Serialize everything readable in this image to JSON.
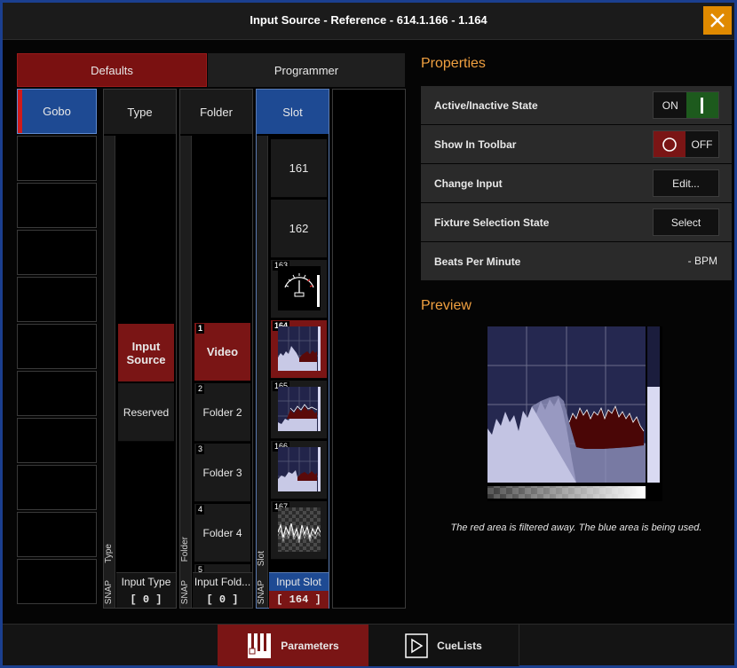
{
  "window": {
    "title": "Input Source - Reference - 614.1.166 - 1.164",
    "close_icon": "close-icon",
    "accent_color": "#1e4a93",
    "selection_color": "#7a1515",
    "heading_color": "#f0a040"
  },
  "tabs": [
    {
      "label": "Defaults",
      "active": true
    },
    {
      "label": "Programmer",
      "active": false
    }
  ],
  "left_list": {
    "items": [
      "Gobo"
    ]
  },
  "type_pane": {
    "header": "Type",
    "snap": "SNAP",
    "side_label": "Type",
    "items": [
      {
        "label": "Input Source",
        "selected": true
      },
      {
        "label": "Reserved",
        "selected": false
      }
    ],
    "footer_title": "Input Type",
    "footer_value": "[ 0 ]"
  },
  "folder_pane": {
    "header": "Folder",
    "snap": "SNAP",
    "side_label": "Folder",
    "items": [
      {
        "num": "1",
        "label": "Video",
        "selected": true
      },
      {
        "num": "2",
        "label": "Folder 2",
        "selected": false
      },
      {
        "num": "3",
        "label": "Folder 3",
        "selected": false
      },
      {
        "num": "4",
        "label": "Folder 4",
        "selected": false
      },
      {
        "num": "5",
        "label": "",
        "selected": false
      }
    ],
    "footer_title": "Input Fold...",
    "footer_value": "[ 0 ]"
  },
  "slot_pane": {
    "header": "Slot",
    "snap": "SNAP",
    "side_label": "Slot",
    "items": [
      {
        "num": "",
        "label": "161",
        "kind": "text"
      },
      {
        "num": "",
        "label": "162",
        "kind": "text"
      },
      {
        "num": "163",
        "label": "",
        "kind": "meter-icon"
      },
      {
        "num": "164",
        "label": "",
        "kind": "spectrum-icon",
        "selected": true
      },
      {
        "num": "165",
        "label": "",
        "kind": "spectrum-icon"
      },
      {
        "num": "166",
        "label": "",
        "kind": "spectrum-icon"
      },
      {
        "num": "167",
        "label": "",
        "kind": "waveform-icon"
      }
    ],
    "footer_title": "Input Slot",
    "footer_value": "[ 164 ]"
  },
  "properties": {
    "heading": "Properties",
    "rows": [
      {
        "label": "Active/Inactive State",
        "control": "toggle",
        "value": "ON",
        "on": true
      },
      {
        "label": "Show In Toolbar",
        "control": "toggle",
        "value": "OFF",
        "on": false
      },
      {
        "label": "Change Input",
        "control": "button",
        "value": "Edit..."
      },
      {
        "label": "Fixture Selection State",
        "control": "button",
        "value": "Select"
      },
      {
        "label": "Beats Per Minute",
        "control": "readout",
        "value": "- BPM"
      }
    ]
  },
  "preview": {
    "heading": "Preview",
    "caption": "The red area is filtered away. The blue area is being used."
  },
  "bottom": {
    "parameters_label": "Parameters",
    "parameters_icon": "sliders-icon",
    "cuelists_label": "CueLists",
    "cuelists_icon": "play-icon"
  }
}
